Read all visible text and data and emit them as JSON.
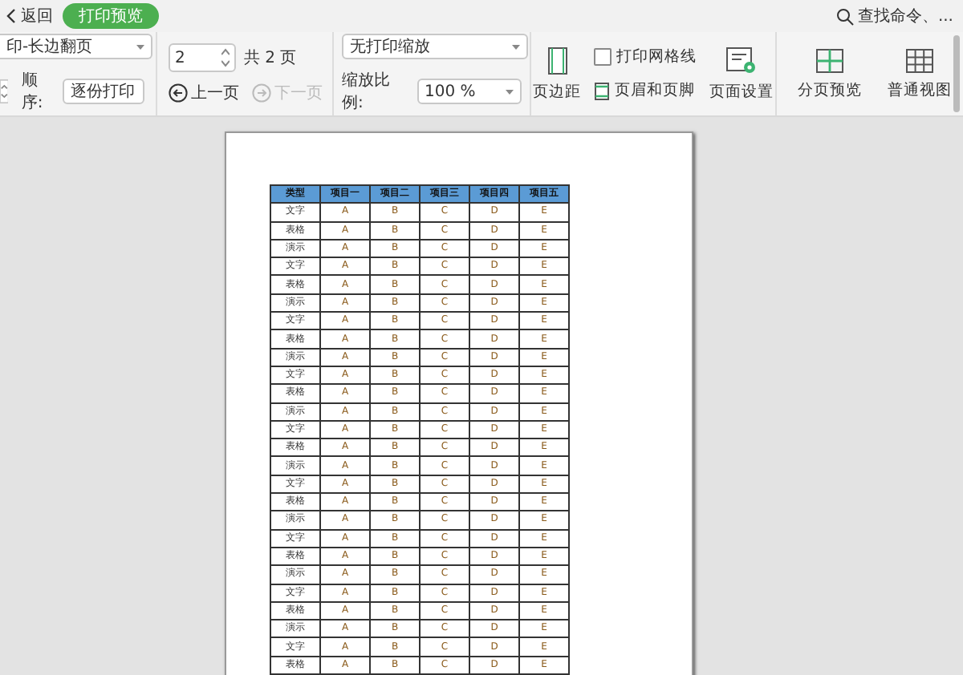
{
  "top_bar": {
    "back": "返回",
    "mode_tab": {
      "label": "打印预览",
      "selected": true
    },
    "search": "查找命令、..."
  },
  "toolbar": {
    "duplex": {
      "value": "印-长边翻页"
    },
    "order": {
      "label": "顺序:",
      "value": "逐份打印"
    },
    "page": {
      "value": "2",
      "total": "共 2 页"
    },
    "prev": {
      "label": "上一页",
      "disabled": false
    },
    "next": {
      "label": "下一页",
      "disabled": true
    },
    "scaling": {
      "value": "无打印缩放"
    },
    "zoom": {
      "label": "缩放比例:",
      "value": "100 %"
    },
    "margins": "页边距",
    "gridlines": {
      "label": "打印网格线",
      "checked": false
    },
    "header_footer": "页眉和页脚",
    "page_setup": "页面设置",
    "views": [
      {
        "kind": "pagebreak",
        "label": "分页预览"
      },
      {
        "kind": "normal",
        "label": "普通视图"
      }
    ]
  },
  "sheet": {
    "columns": [
      "类型",
      "项目一",
      "项目二",
      "项目三",
      "项目四",
      "项目五"
    ],
    "rows": [
      [
        "文字",
        "A",
        "B",
        "C",
        "D",
        "E"
      ],
      [
        "表格",
        "A",
        "B",
        "C",
        "D",
        "E"
      ],
      [
        "演示",
        "A",
        "B",
        "C",
        "D",
        "E"
      ],
      [
        "文字",
        "A",
        "B",
        "C",
        "D",
        "E"
      ],
      [
        "表格",
        "A",
        "B",
        "C",
        "D",
        "E"
      ],
      [
        "演示",
        "A",
        "B",
        "C",
        "D",
        "E"
      ],
      [
        "文字",
        "A",
        "B",
        "C",
        "D",
        "E"
      ],
      [
        "表格",
        "A",
        "B",
        "C",
        "D",
        "E"
      ],
      [
        "演示",
        "A",
        "B",
        "C",
        "D",
        "E"
      ],
      [
        "文字",
        "A",
        "B",
        "C",
        "D",
        "E"
      ],
      [
        "表格",
        "A",
        "B",
        "C",
        "D",
        "E"
      ],
      [
        "演示",
        "A",
        "B",
        "C",
        "D",
        "E"
      ],
      [
        "文字",
        "A",
        "B",
        "C",
        "D",
        "E"
      ],
      [
        "表格",
        "A",
        "B",
        "C",
        "D",
        "E"
      ],
      [
        "演示",
        "A",
        "B",
        "C",
        "D",
        "E"
      ],
      [
        "文字",
        "A",
        "B",
        "C",
        "D",
        "E"
      ],
      [
        "表格",
        "A",
        "B",
        "C",
        "D",
        "E"
      ],
      [
        "演示",
        "A",
        "B",
        "C",
        "D",
        "E"
      ],
      [
        "文字",
        "A",
        "B",
        "C",
        "D",
        "E"
      ],
      [
        "表格",
        "A",
        "B",
        "C",
        "D",
        "E"
      ],
      [
        "演示",
        "A",
        "B",
        "C",
        "D",
        "E"
      ],
      [
        "文字",
        "A",
        "B",
        "C",
        "D",
        "E"
      ],
      [
        "表格",
        "A",
        "B",
        "C",
        "D",
        "E"
      ],
      [
        "演示",
        "A",
        "B",
        "C",
        "D",
        "E"
      ],
      [
        "文字",
        "A",
        "B",
        "C",
        "D",
        "E"
      ],
      [
        "表格",
        "A",
        "B",
        "C",
        "D",
        "E"
      ]
    ]
  }
}
